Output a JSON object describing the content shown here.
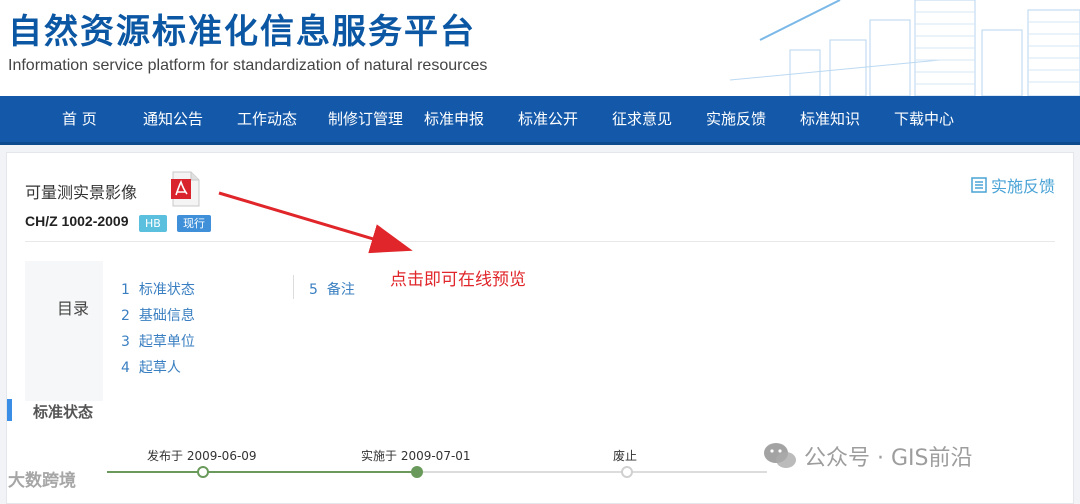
{
  "header": {
    "title": "自然资源标准化信息服务平台",
    "subtitle": "Information service platform for standardization of natural resources"
  },
  "nav": {
    "items": [
      {
        "label": "首 页"
      },
      {
        "label": "通知公告"
      },
      {
        "label": "工作动态"
      },
      {
        "label": "制修订管理"
      },
      {
        "label": "标准申报"
      },
      {
        "label": "标准公开"
      },
      {
        "label": "征求意见"
      },
      {
        "label": "实施反馈"
      },
      {
        "label": "标准知识"
      },
      {
        "label": "下载中心"
      }
    ]
  },
  "document": {
    "title": "可量测实景影像",
    "code": "CH/Z 1002-2009",
    "badge_type": "HB",
    "badge_status": "现行",
    "pdf_icon": "pdf-icon"
  },
  "feedback": {
    "label": "实施反馈",
    "icon": "list-icon"
  },
  "toc": {
    "label": "目录",
    "items": [
      {
        "num": "1",
        "label": "标准状态"
      },
      {
        "num": "2",
        "label": "基础信息"
      },
      {
        "num": "3",
        "label": "起草单位"
      },
      {
        "num": "4",
        "label": "起草人"
      },
      {
        "num": "5",
        "label": "备注"
      }
    ]
  },
  "annotation": {
    "text": "点击即可在线预览",
    "color": "#e0262a"
  },
  "status_section": {
    "title": "标准状态",
    "timeline": [
      {
        "label": "发布于 2009-06-09",
        "state": "done"
      },
      {
        "label": "实施于 2009-07-01",
        "state": "current"
      },
      {
        "label": "废止",
        "state": "pending"
      }
    ]
  },
  "watermarks": {
    "left": "大数跨境",
    "right": "公众号 · GIS前沿"
  },
  "colors": {
    "brand_blue": "#0c57a3",
    "nav_blue": "#1459a9",
    "link_blue": "#3a7fc1",
    "timeline_green": "#6a9a5b"
  }
}
